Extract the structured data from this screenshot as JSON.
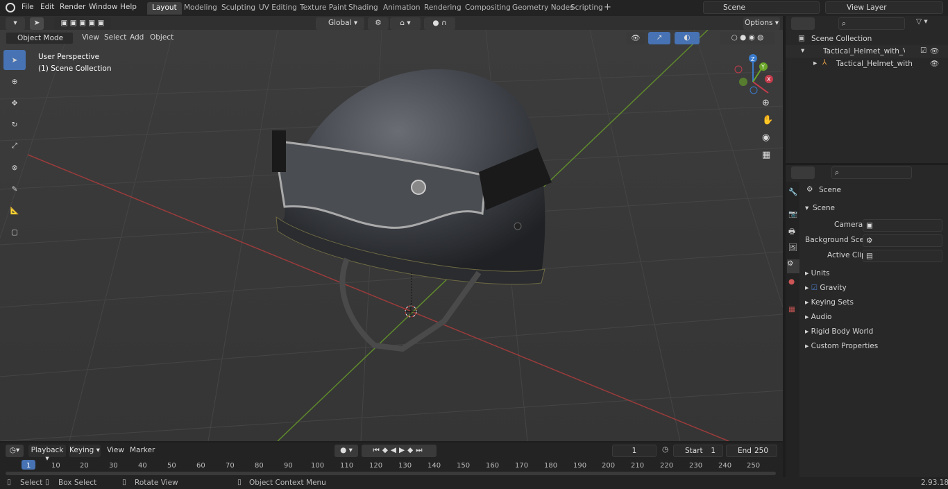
{
  "topbar": {
    "menus": [
      "File",
      "Edit",
      "Render",
      "Window",
      "Help"
    ],
    "workspaces": [
      "Layout",
      "Modeling",
      "Sculpting",
      "UV Editing",
      "Texture Paint",
      "Shading",
      "Animation",
      "Rendering",
      "Compositing",
      "Geometry Nodes",
      "Scripting"
    ],
    "active_workspace": "Layout",
    "scene": "Scene",
    "view_layer": "View Layer"
  },
  "viewport": {
    "mode": "Object Mode",
    "menus": [
      "View",
      "Select",
      "Add",
      "Object"
    ],
    "transform_orientation": "Global",
    "options": "Options",
    "overlay_text": [
      "User Perspective",
      "(1) Scene Collection"
    ]
  },
  "outliner": {
    "root": "Scene Collection",
    "items": [
      "Tactical_Helmet_with_Visor_G",
      "Tactical_Helmet_with_Vis"
    ]
  },
  "properties": {
    "header": "Scene",
    "panel": "Scene",
    "camera_label": "Camera",
    "background_label": "Background Scene",
    "clip_label": "Active Clip",
    "sections": [
      "Units",
      "Gravity",
      "Keying Sets",
      "Audio",
      "Rigid Body World",
      "Custom Properties"
    ]
  },
  "timeline": {
    "menus": [
      "Playback",
      "Keying",
      "View",
      "Marker"
    ],
    "current_frame": "1",
    "start_label": "Start",
    "start": "1",
    "end_label": "End",
    "end": "250",
    "ticks": [
      "1",
      "10",
      "20",
      "30",
      "40",
      "50",
      "60",
      "70",
      "80",
      "90",
      "100",
      "110",
      "120",
      "130",
      "140",
      "150",
      "160",
      "170",
      "180",
      "190",
      "200",
      "210",
      "220",
      "230",
      "240",
      "250"
    ]
  },
  "status": {
    "select": "Select",
    "box_select": "Box Select",
    "rotate": "Rotate View",
    "context": "Object Context Menu",
    "version": "2.93.18"
  }
}
